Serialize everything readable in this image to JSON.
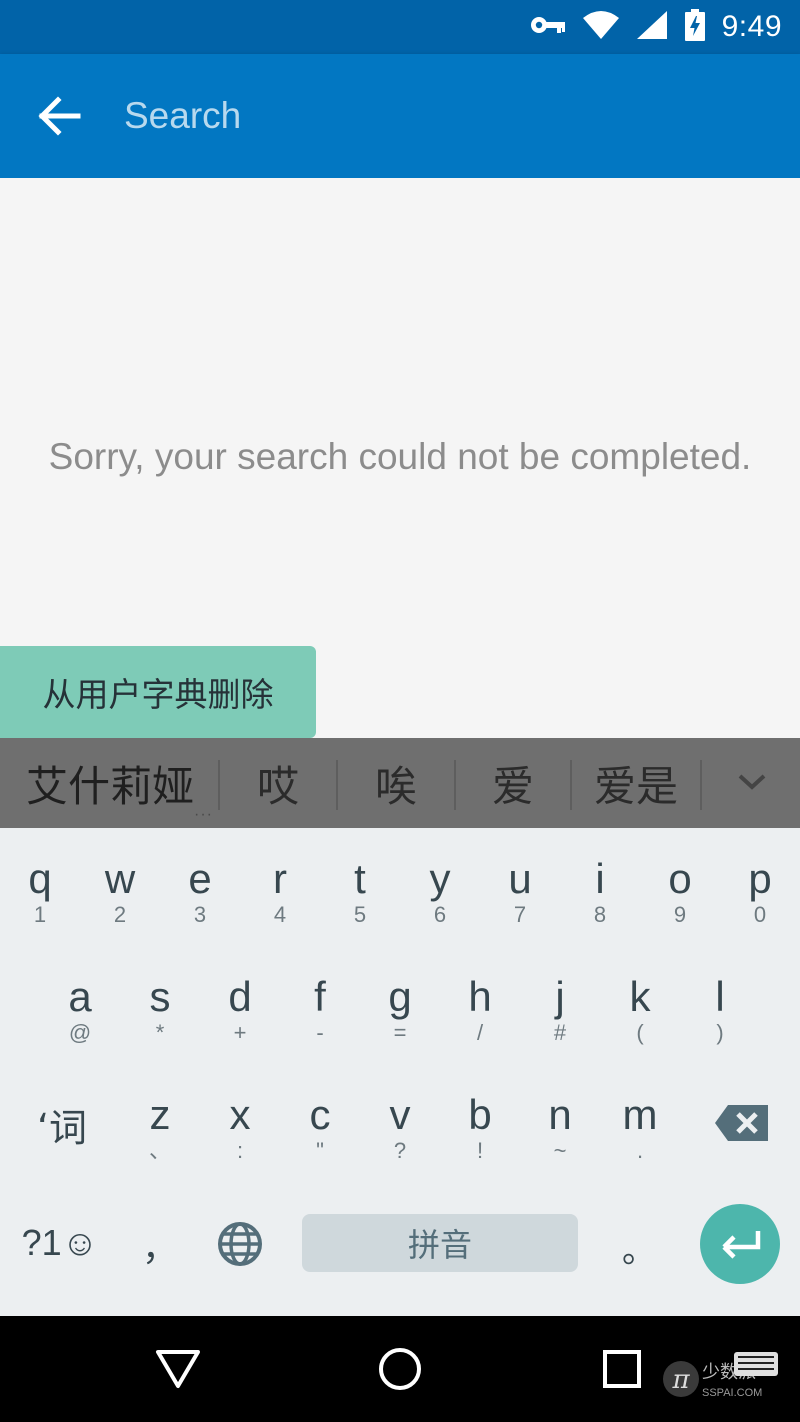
{
  "status_bar": {
    "time": "9:49",
    "icons": [
      "key-icon",
      "wifi-icon",
      "signal-icon",
      "battery-charging-icon"
    ]
  },
  "app_bar": {
    "back_icon": "arrow-back-icon",
    "search_placeholder": "Search",
    "color": "#0277c2"
  },
  "message": "Sorry, your search could not be completed.",
  "dictionary_popup": "从用户字典删除",
  "candidates": {
    "primary": "艾什莉娅",
    "items": [
      "哎",
      "唉",
      "爱",
      "爱是"
    ],
    "expand_icon": "chevron-down-icon"
  },
  "keyboard": {
    "row1": [
      {
        "key": "q",
        "hint": "1"
      },
      {
        "key": "w",
        "hint": "2"
      },
      {
        "key": "e",
        "hint": "3"
      },
      {
        "key": "r",
        "hint": "4"
      },
      {
        "key": "t",
        "hint": "5"
      },
      {
        "key": "y",
        "hint": "6"
      },
      {
        "key": "u",
        "hint": "7"
      },
      {
        "key": "i",
        "hint": "8"
      },
      {
        "key": "o",
        "hint": "9"
      },
      {
        "key": "p",
        "hint": "0"
      }
    ],
    "row2": [
      {
        "key": "a",
        "hint": "@"
      },
      {
        "key": "s",
        "hint": "*"
      },
      {
        "key": "d",
        "hint": "+"
      },
      {
        "key": "f",
        "hint": "-"
      },
      {
        "key": "g",
        "hint": "="
      },
      {
        "key": "h",
        "hint": "/"
      },
      {
        "key": "j",
        "hint": "#"
      },
      {
        "key": "k",
        "hint": "("
      },
      {
        "key": "l",
        "hint": ")"
      }
    ],
    "row3": [
      {
        "key": "z",
        "hint": "、"
      },
      {
        "key": "x",
        "hint": ":"
      },
      {
        "key": "c",
        "hint": "\""
      },
      {
        "key": "v",
        "hint": "?"
      },
      {
        "key": "b",
        "hint": "!"
      },
      {
        "key": "n",
        "hint": "~"
      },
      {
        "key": "m",
        "hint": "."
      }
    ],
    "word_key": "‘词",
    "symbols_key": "?1☺",
    "comma_key": "，",
    "space_label": "拼音",
    "period_key": "。",
    "accent": "#4db6ac"
  },
  "watermark": {
    "text_cn": "少数派",
    "text_en": "SSPAI.COM"
  }
}
